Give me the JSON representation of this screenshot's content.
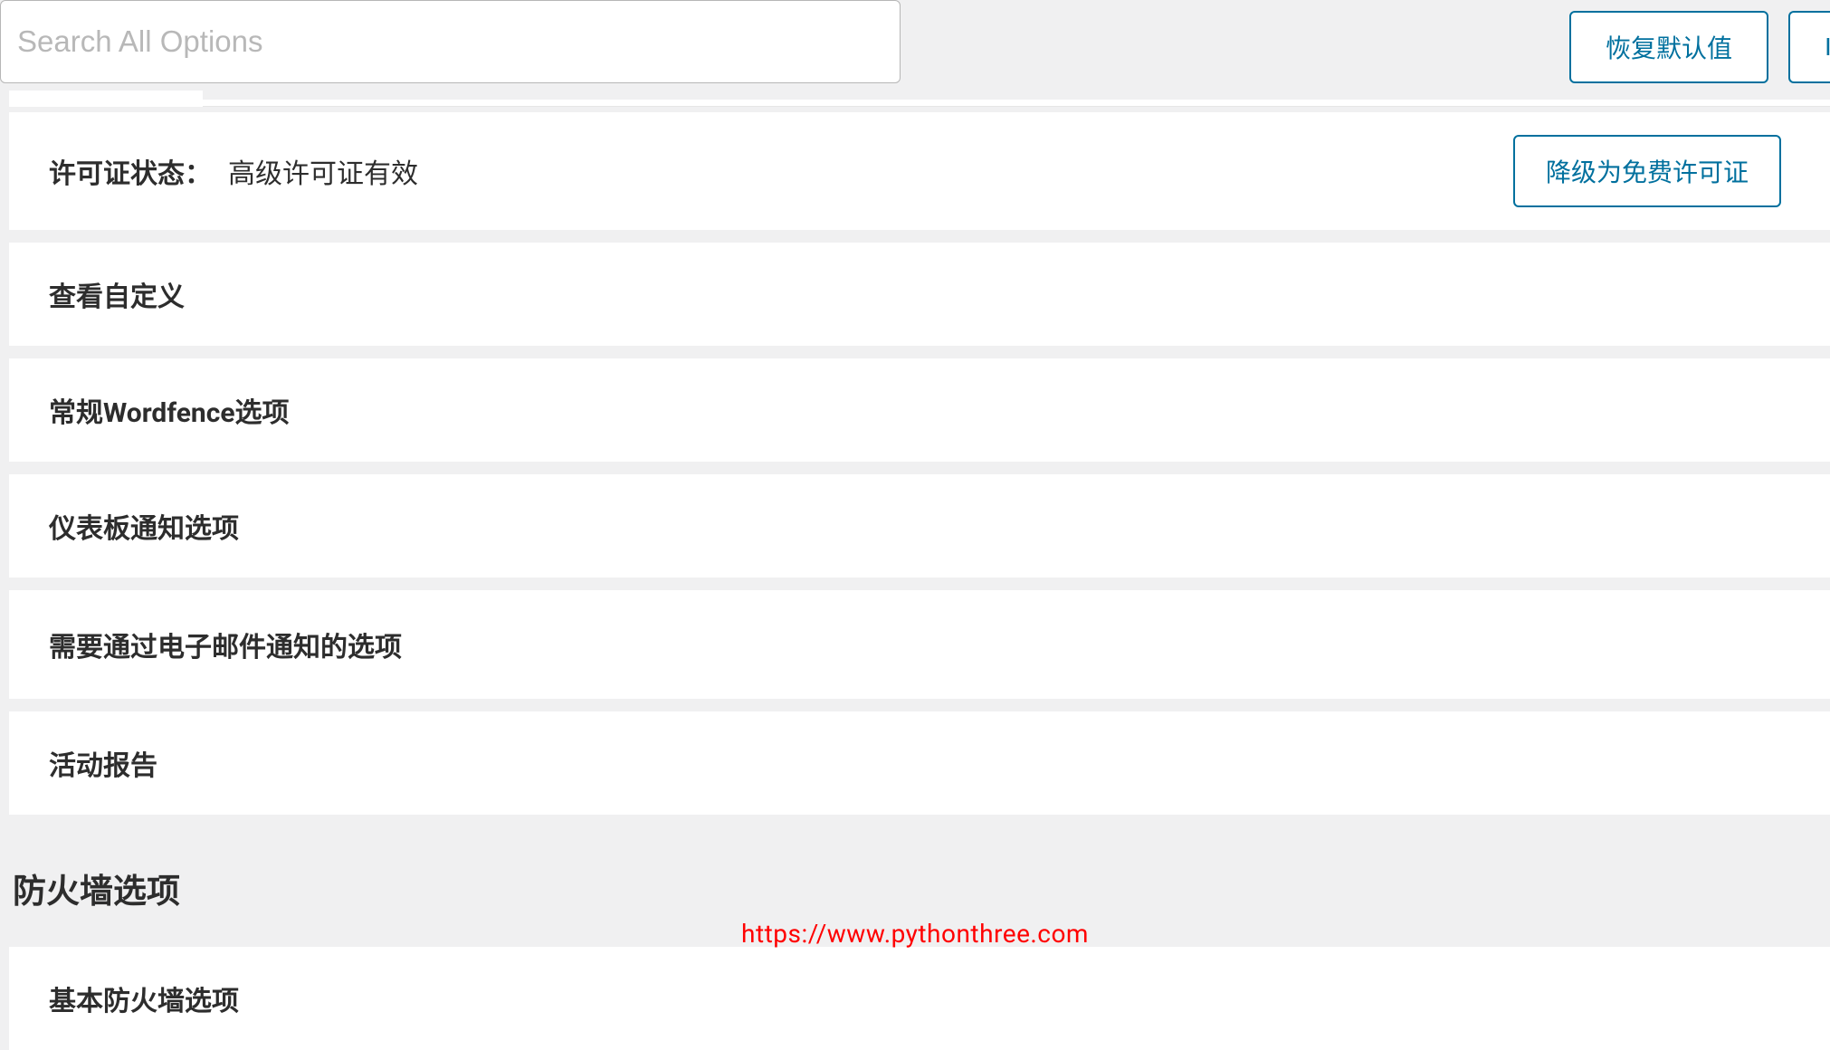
{
  "search": {
    "placeholder": "Search All Options"
  },
  "topButtons": {
    "restore": "恢复默认值",
    "partial": "I"
  },
  "license": {
    "label": "许可证状态：",
    "value": "高级许可证有效",
    "downgrade": "降级为免费许可证"
  },
  "panels": [
    "查看自定义",
    "常规Wordfence选项",
    "仪表板通知选项",
    "需要通过电子邮件通知的选项",
    "活动报告"
  ],
  "sectionHeading": "防火墙选项",
  "firewallPanels": [
    "基本防火墙选项"
  ],
  "watermark": "https://www.pythonthree.com"
}
